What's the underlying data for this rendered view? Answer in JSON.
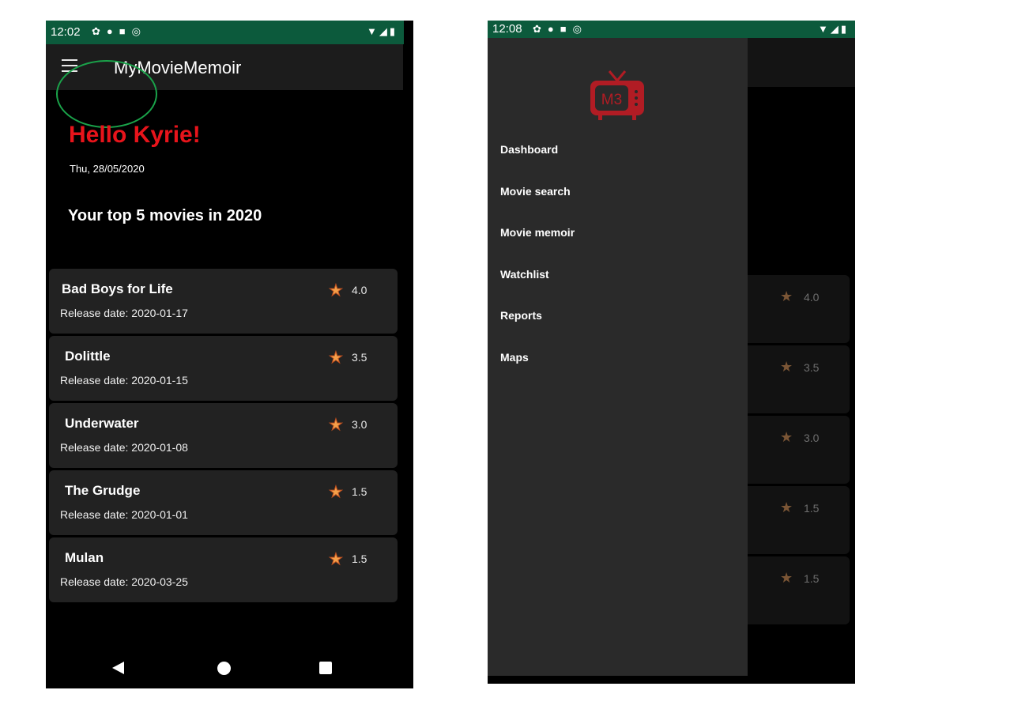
{
  "left_screen": {
    "status": {
      "time": "12:02"
    },
    "app_title": "MyMovieMemoir",
    "greeting": "Hello Kyrie!",
    "date": "Thu, 28/05/2020",
    "top5_heading": "Your top 5 movies in 2020",
    "movies": [
      {
        "title": "Bad Boys for Life",
        "release": "Release date: 2020-01-17",
        "rating": "4.0"
      },
      {
        "title": "Dolittle",
        "release": "Release date: 2020-01-15",
        "rating": "3.5"
      },
      {
        "title": "Underwater",
        "release": "Release date: 2020-01-08",
        "rating": "3.0"
      },
      {
        "title": "The Grudge",
        "release": "Release date: 2020-01-01",
        "rating": "1.5"
      },
      {
        "title": "Mulan",
        "release": "Release date: 2020-03-25",
        "rating": "1.5"
      }
    ]
  },
  "right_screen": {
    "status": {
      "time": "12:08"
    },
    "drawer_items": [
      "Dashboard",
      "Movie search",
      "Movie memoir",
      "Watchlist",
      "Reports",
      "Maps"
    ],
    "logo_text": "M3",
    "ratings": [
      "4.0",
      "3.5",
      "3.0",
      "1.5",
      "1.5"
    ]
  },
  "icons": {
    "menu": "hamburger-menu-icon",
    "star": "star-icon",
    "nav": [
      "back-icon",
      "home-icon",
      "recents-icon"
    ]
  },
  "colors": {
    "status_bar": "#0c5a3c",
    "greeting": "#e8141b",
    "card": "#222222",
    "highlight_ring": "#1aa34a",
    "star": "#f4a04a",
    "logo": "#b11c24"
  }
}
